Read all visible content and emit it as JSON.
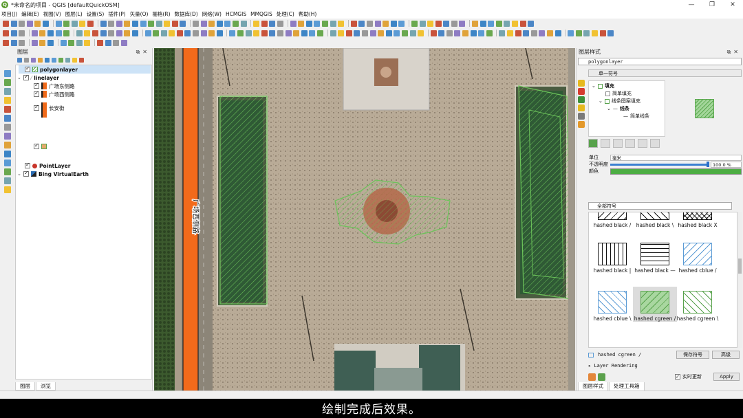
{
  "window": {
    "title": "*未命名的项目 - QGIS [defaultQuickOSM]",
    "controls": [
      "—",
      "❐",
      "✕"
    ]
  },
  "menu": [
    "项目(J)",
    "编辑(E)",
    "视图(V)",
    "图层(L)",
    "设置(S)",
    "插件(P)",
    "矢量(O)",
    "栅格(R)",
    "数据库(D)",
    "网络(W)",
    "HCMGIS",
    "MMQGIS",
    "处理(C)",
    "帮助(H)"
  ],
  "layers_panel": {
    "title": "图层",
    "tabs": [
      "图层",
      "浏览"
    ],
    "items": [
      {
        "label": "polygonlayer",
        "bold": true,
        "checked": true
      },
      {
        "label": "linelayer",
        "bold": true,
        "checked": true
      },
      {
        "label": "广场东侧路",
        "checked": true
      },
      {
        "label": "广场西侧路",
        "checked": true
      },
      {
        "label": "长安街",
        "checked": true
      },
      {
        "label": "",
        "checked": true
      },
      {
        "label": "PointLayer",
        "bold": true,
        "checked": true
      },
      {
        "label": "Bing VirtualEarth",
        "bold": true,
        "checked": true
      }
    ]
  },
  "map": {
    "road_label": "广场西侧路"
  },
  "styling_panel": {
    "title": "图层样式",
    "layer": "polygonlayer",
    "renderer": "单一符号",
    "tree": [
      "填充",
      "简单填充",
      "线条图案填充",
      "线条",
      "简单线条"
    ],
    "unit_label": "单位",
    "unit_value": "毫米",
    "opacity_label": "不透明度",
    "opacity_value": "100.0 %",
    "opacity": 1.0,
    "color_label": "颜色",
    "color": "#4cad43",
    "search_placeholder": "全部符号",
    "symbols": [
      {
        "label": "hashed black /",
        "kind": "diag",
        "color": "#111111",
        "fill": "#ffffff"
      },
      {
        "label": "hashed black \\",
        "kind": "back",
        "color": "#111111",
        "fill": "#ffffff"
      },
      {
        "label": "hashed black X",
        "kind": "cross",
        "color": "#111111",
        "fill": "#ffffff"
      },
      {
        "label": "hashed black |",
        "kind": "vert",
        "color": "#111111",
        "fill": "#ffffff"
      },
      {
        "label": "hashed black —",
        "kind": "horiz",
        "color": "#111111",
        "fill": "#ffffff"
      },
      {
        "label": "hashed cblue /",
        "kind": "diag",
        "color": "#5b9bd5",
        "fill": "#ffffff"
      },
      {
        "label": "hashed cblue \\",
        "kind": "back",
        "color": "#5b9bd5",
        "fill": "#ffffff"
      },
      {
        "label": "hashed cgreen /",
        "kind": "diag",
        "color": "#58a24c",
        "fill": "#a9d7a0"
      },
      {
        "label": "hashed cgreen \\",
        "kind": "back",
        "color": "#58a24c",
        "fill": "#ffffff"
      }
    ],
    "selected_symbol": "hashed cgreen /",
    "save_symbol": "保存符号",
    "advanced": "高级",
    "layer_rendering": "Layer Rendering",
    "live_update": "实时更新",
    "apply": "Apply",
    "tabs": [
      "图层样式",
      "处理工具箱"
    ]
  },
  "subtitle": "绘制完成后效果。"
}
